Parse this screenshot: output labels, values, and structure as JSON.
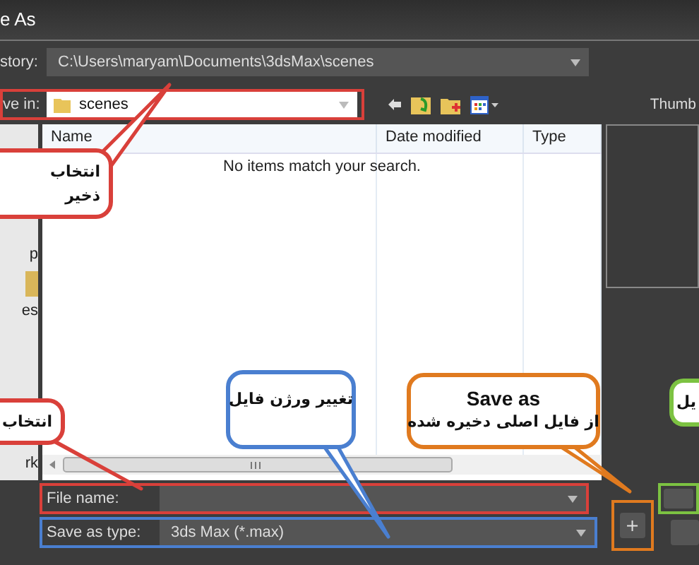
{
  "window": {
    "title": "e As"
  },
  "history": {
    "label": "story:",
    "value": "C:\\Users\\maryam\\Documents\\3dsMax\\scenes"
  },
  "save_in": {
    "label": "ve in:",
    "value": "scenes"
  },
  "thumbnail": {
    "label": "Thumb"
  },
  "places": [
    {
      "label": "p"
    },
    {
      "label": "es"
    },
    {
      "label": "rk"
    }
  ],
  "file_list": {
    "columns": [
      "Name",
      "Date modified",
      "Type"
    ],
    "empty_message": "No items match your search."
  },
  "file_name": {
    "label": "File name:"
  },
  "save_as_type": {
    "label": "Save as type:",
    "value": "3ds Max (*.max)"
  },
  "add_button": {
    "label": "+"
  },
  "annotations": [
    {
      "color": "#d9403a",
      "lines": [
        "انتخاب",
        "ذخیر"
      ]
    },
    {
      "color": "#7cc242",
      "lines": [
        "یل"
      ]
    },
    {
      "color": "#e07a1f",
      "title": "Save as",
      "lines": [
        "از فایل اصلی دخیره شده"
      ]
    },
    {
      "color": "#4a7fd0",
      "lines": [
        "تغییر ورژن فایل"
      ]
    },
    {
      "color": "#d9403a",
      "lines": [
        "انتخاب"
      ]
    }
  ]
}
